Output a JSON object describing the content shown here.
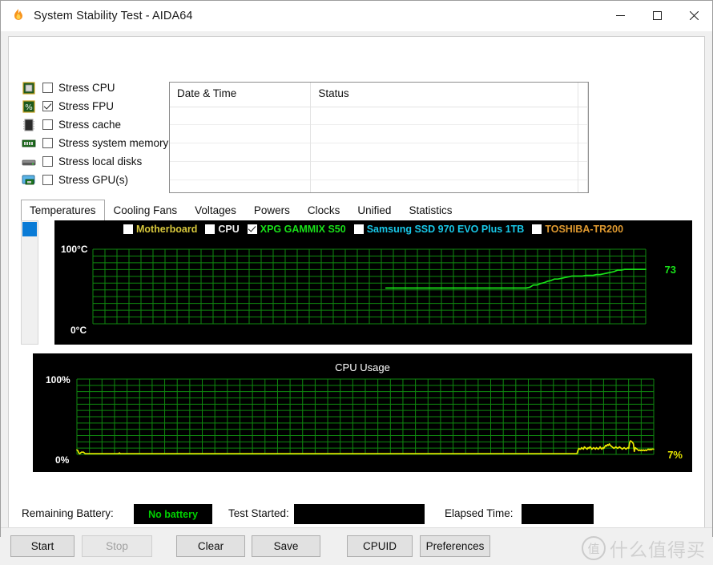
{
  "window": {
    "title": "System Stability Test - AIDA64",
    "icon": "flame-icon",
    "minimize": "—",
    "maximize": "☐",
    "close": "✕"
  },
  "stress_options": [
    {
      "label": "Stress CPU",
      "checked": false,
      "icon": "cpu-chip-icon"
    },
    {
      "label": "Stress FPU",
      "checked": true,
      "icon": "fpu-chip-icon"
    },
    {
      "label": "Stress cache",
      "checked": false,
      "icon": "cache-icon"
    },
    {
      "label": "Stress system memory",
      "checked": false,
      "icon": "memory-module-icon"
    },
    {
      "label": "Stress local disks",
      "checked": false,
      "icon": "hard-disk-icon"
    },
    {
      "label": "Stress GPU(s)",
      "checked": false,
      "icon": "gpu-monitor-icon"
    }
  ],
  "log": {
    "columns": [
      "Date & Time",
      "Status"
    ],
    "rows": []
  },
  "tabs": [
    {
      "label": "Temperatures",
      "active": true
    },
    {
      "label": "Cooling Fans",
      "active": false
    },
    {
      "label": "Voltages",
      "active": false
    },
    {
      "label": "Powers",
      "active": false
    },
    {
      "label": "Clocks",
      "active": false
    },
    {
      "label": "Unified",
      "active": false
    },
    {
      "label": "Statistics",
      "active": false
    }
  ],
  "legend": [
    {
      "label": "Motherboard",
      "checked": false,
      "color": "#d8c83c"
    },
    {
      "label": "CPU",
      "checked": false,
      "color": "#f0f0f0"
    },
    {
      "label": "XPG GAMMIX S50",
      "checked": true,
      "color": "#19e019"
    },
    {
      "label": "Samsung SSD 970 EVO Plus 1TB",
      "checked": false,
      "color": "#18c8e8"
    },
    {
      "label": "TOSHIBA-TR200",
      "checked": false,
      "color": "#e09a30"
    }
  ],
  "status": {
    "battery_label": "Remaining Battery:",
    "battery_value": "No battery",
    "started_label": "Test Started:",
    "started_value": "",
    "elapsed_label": "Elapsed Time:",
    "elapsed_value": ""
  },
  "buttons": [
    {
      "label": "Start",
      "enabled": true
    },
    {
      "label": "Stop",
      "enabled": false
    },
    {
      "label": "Clear",
      "enabled": true
    },
    {
      "label": "Save",
      "enabled": true
    },
    {
      "label": "CPUID",
      "enabled": true
    },
    {
      "label": "Preferences",
      "enabled": true
    }
  ],
  "watermark": {
    "logo": "值",
    "text": "什么值得买"
  },
  "chart_data": [
    {
      "type": "line",
      "title": "",
      "ylabel": "",
      "xlabel": "",
      "y_top_label": "100°C",
      "y_bottom_label": "0°C",
      "ylim": [
        0,
        100
      ],
      "grid": true,
      "series": [
        {
          "name": "XPG GAMMIX S50",
          "color": "#19e019",
          "end_label": "73",
          "values": [
            48,
            48,
            48,
            48,
            48,
            48,
            48,
            48,
            48,
            48,
            48,
            48,
            48,
            48,
            48,
            48,
            48,
            48,
            48,
            48,
            48,
            48,
            48,
            48,
            48,
            48,
            48,
            48,
            48,
            48,
            48,
            48,
            48,
            48,
            48,
            48,
            48,
            48,
            48,
            48,
            48,
            49,
            52,
            52,
            54,
            55,
            57,
            58,
            60,
            60,
            61,
            62,
            63,
            64,
            64,
            64,
            64,
            65,
            65,
            65,
            66,
            66,
            67,
            68,
            69,
            70,
            72,
            72,
            73,
            73,
            73,
            73,
            73,
            73,
            73
          ]
        }
      ]
    },
    {
      "type": "line",
      "title": "CPU Usage",
      "ylabel": "",
      "xlabel": "",
      "y_top_label": "100%",
      "y_bottom_label": "0%",
      "ylim": [
        0,
        100
      ],
      "grid": true,
      "series": [
        {
          "name": "CPU Usage",
          "color": "#e8e800",
          "end_label": "7%",
          "values": [
            6,
            5,
            2,
            1,
            2,
            3,
            3,
            3,
            2,
            1,
            1,
            1,
            1,
            1,
            1,
            1,
            1,
            1,
            1,
            1,
            1,
            1,
            1,
            1,
            1,
            1,
            1,
            1,
            1,
            1,
            1,
            1,
            1,
            1,
            1,
            1,
            1,
            1,
            1,
            1,
            1,
            1,
            1,
            1,
            1,
            1,
            2,
            1,
            1,
            1,
            1,
            1,
            1,
            1,
            1,
            1,
            1,
            1,
            1,
            1,
            1,
            1,
            1,
            1,
            1,
            1,
            1,
            1,
            1,
            1,
            1,
            1,
            1,
            1,
            1,
            1,
            1,
            1,
            1,
            1,
            1,
            1,
            1,
            1,
            1,
            1,
            1,
            1,
            1,
            1,
            1,
            1,
            1,
            1,
            1,
            1,
            1,
            1,
            1,
            1,
            1,
            1,
            1,
            1,
            1,
            1,
            1,
            1,
            1,
            1,
            1,
            1,
            1,
            1,
            1,
            1,
            1,
            1,
            1,
            1,
            1,
            1,
            1,
            1,
            1,
            1,
            1,
            1,
            1,
            1,
            1,
            1,
            1,
            1,
            1,
            1,
            1,
            1,
            1,
            1,
            1,
            1,
            1,
            1,
            1,
            1,
            1,
            1,
            1,
            1,
            1,
            1,
            1,
            1,
            1,
            1,
            1,
            1,
            1,
            1,
            1,
            1,
            1,
            1,
            1,
            1,
            1,
            1,
            1,
            1,
            1,
            1,
            1,
            1,
            1,
            1,
            1,
            1,
            1,
            1,
            1,
            1,
            1,
            1,
            1,
            1,
            1,
            1,
            1,
            1,
            1,
            1,
            1,
            1,
            1,
            1,
            1,
            1,
            1,
            1,
            1,
            1,
            1,
            1,
            1,
            1,
            1,
            1,
            1,
            1,
            1,
            1,
            1,
            1,
            1,
            1,
            1,
            1,
            1,
            1,
            1,
            1,
            1,
            1,
            1,
            1,
            1,
            1,
            1,
            1,
            1,
            1,
            1,
            1,
            1,
            1,
            1,
            1,
            1,
            1,
            1,
            1,
            1,
            1,
            1,
            1,
            1,
            1,
            1,
            1,
            1,
            1,
            1,
            1,
            1,
            1,
            1,
            1,
            1,
            1,
            1,
            1,
            1,
            1,
            1,
            1,
            1,
            1,
            1,
            1,
            1,
            1,
            1,
            1,
            1,
            1,
            1,
            1,
            1,
            1,
            1,
            1,
            1,
            1,
            1,
            1,
            1,
            1,
            1,
            1,
            1,
            1,
            1,
            1,
            1,
            1,
            1,
            1,
            1,
            1,
            1,
            1,
            1,
            1,
            1,
            1,
            1,
            1,
            1,
            1,
            1,
            1,
            1,
            1,
            1,
            1,
            1,
            1,
            1,
            1,
            1,
            1,
            1,
            1,
            1,
            1,
            1,
            1,
            1,
            1,
            1,
            1,
            1,
            1,
            1,
            1,
            1,
            1,
            1,
            1,
            1,
            1,
            1,
            1,
            1,
            1,
            1,
            1,
            1,
            1,
            1,
            1,
            1,
            1,
            1,
            1,
            1,
            1,
            1,
            1,
            1,
            1,
            1,
            1,
            1,
            1,
            1,
            1,
            1,
            1,
            1,
            1,
            1,
            1,
            1,
            1,
            1,
            1,
            1,
            1,
            1,
            1,
            1,
            1,
            1,
            1,
            1,
            1,
            1,
            1,
            1,
            1,
            1,
            1,
            1,
            1,
            1,
            1,
            1,
            1,
            1,
            1,
            1,
            1,
            1,
            1,
            1,
            1,
            1,
            1,
            1,
            1,
            1,
            1,
            1,
            1,
            1,
            1,
            1,
            1,
            1,
            1,
            1,
            1,
            1,
            1,
            1,
            1,
            1,
            1,
            1,
            1,
            1,
            1,
            1,
            1,
            1,
            1,
            1,
            1,
            1,
            1,
            1,
            1,
            1,
            1,
            1,
            1,
            1,
            1,
            1,
            1,
            1,
            1,
            1,
            1,
            1,
            1,
            1,
            1,
            1,
            1,
            1,
            1,
            1,
            1,
            1,
            1,
            1,
            1,
            1,
            1,
            1,
            1,
            1,
            1,
            1,
            1,
            1,
            1,
            1,
            1,
            1,
            1,
            1,
            1,
            1,
            1,
            1,
            1,
            1,
            1,
            1,
            1,
            1,
            1,
            1,
            1,
            1,
            1,
            1,
            1,
            1,
            1,
            1,
            1,
            1,
            1,
            1,
            1,
            1,
            1,
            1,
            1,
            1,
            1,
            1,
            1,
            1,
            1,
            1,
            1,
            1,
            1,
            1,
            1,
            1,
            1,
            1,
            1,
            1,
            1,
            1,
            1,
            1,
            1,
            1,
            1,
            1,
            1,
            1,
            1,
            5,
            8,
            7,
            7,
            9,
            8,
            7,
            10,
            9,
            8,
            7,
            9,
            8,
            10,
            9,
            7,
            8,
            9,
            8,
            7,
            9,
            8,
            7,
            8,
            10,
            8,
            7,
            9,
            8,
            10,
            12,
            11,
            13,
            12,
            14,
            12,
            11,
            10,
            9,
            8,
            9,
            10,
            9,
            8,
            9,
            10,
            9,
            8,
            7,
            8,
            9,
            8,
            7,
            8,
            9,
            8,
            16,
            18,
            17,
            16,
            14,
            4,
            9,
            8,
            7,
            6,
            5,
            6,
            5,
            6,
            5,
            6,
            5,
            6,
            5,
            6,
            7,
            6,
            7,
            6,
            7,
            7,
            7
          ]
        }
      ]
    }
  ]
}
